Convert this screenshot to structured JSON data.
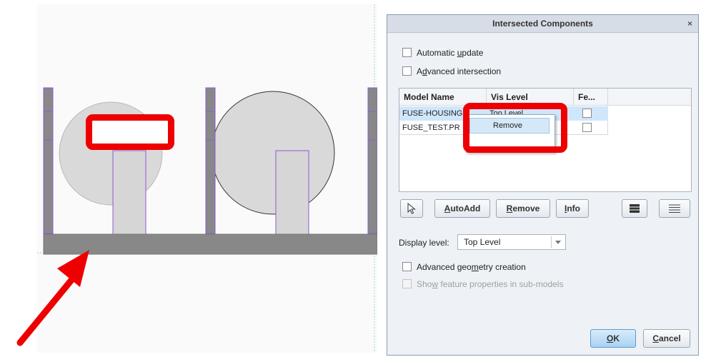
{
  "dialog": {
    "title": "Intersected Components",
    "close_glyph": "×",
    "automatic_update": {
      "pre": "Automatic ",
      "key": "u",
      "post": "pdate",
      "checked": false
    },
    "advanced_intersection": {
      "pre": "A",
      "key": "d",
      "post": "vanced intersection",
      "checked": false
    },
    "table": {
      "columns": [
        "Model Name",
        "Vis Level",
        "Fe..."
      ],
      "rows": [
        {
          "model": "FUSE-HOUSING",
          "vis": "Top Level",
          "feature_checked": false,
          "selected": true
        },
        {
          "model": "FUSE_TEST.PR",
          "vis": "",
          "feature_checked": false,
          "selected": false
        }
      ]
    },
    "buttons": {
      "select_icon": "pointer-arrow-icon",
      "autoadd": {
        "key": "A",
        "rest": "utoAdd"
      },
      "remove": {
        "key": "R",
        "rest": "emove"
      },
      "info": {
        "key": "I",
        "rest": "nfo"
      },
      "view_icons": [
        "list-view-compact-icon",
        "list-view-detail-icon"
      ]
    },
    "display_level": {
      "label": "Display level:",
      "value": "Top Level"
    },
    "advanced_geometry": {
      "pre": "Advanced geo",
      "key": "m",
      "post": "etry creation",
      "checked": false
    },
    "show_feature_props": {
      "pre": "Sho",
      "key": "w",
      "post": " feature properties in sub-models",
      "checked": false,
      "disabled": true
    },
    "ok": {
      "key": "O",
      "rest": "K"
    },
    "cancel": {
      "key": "C",
      "rest": "ancel"
    }
  },
  "context_menu": {
    "items": [
      "Remove"
    ]
  },
  "annotations": {
    "color": "#ee0000"
  },
  "colors": {
    "part_gray": "#888888",
    "circle_fill": "#d9d9d9",
    "edge_purple": "#8e5bd0",
    "highlight": "#cfe6fb"
  }
}
